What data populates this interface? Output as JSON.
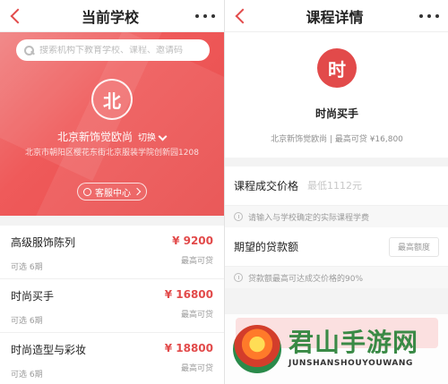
{
  "left": {
    "header": {
      "title": "当前学校"
    },
    "search": {
      "placeholder": "搜索机构下教育学校、课程、邀请码"
    },
    "school": {
      "logo_text": "北",
      "name": "北京新饰觉欧尚",
      "switch_label": "切换",
      "address": "北京市朝阳区樱花东街北京服装学院创新园1208",
      "service_label": "客服中心"
    },
    "courses": [
      {
        "name": "高级服饰陈列",
        "sub": "可选 6期",
        "price": "¥ 9200",
        "max": "最高可贷"
      },
      {
        "name": "时尚买手",
        "sub": "可选 6期",
        "price": "¥ 16800",
        "max": "最高可贷"
      },
      {
        "name": "时尚造型与彩妆",
        "sub": "可选 6期",
        "price": "¥ 18800",
        "max": "最高可贷"
      }
    ]
  },
  "right": {
    "header": {
      "title": "课程详情"
    },
    "course": {
      "logo_text": "时",
      "title": "时尚买手",
      "meta": "北京新饰觉欧尚 | 最高可贷 ¥16,800"
    },
    "form": {
      "price_label": "课程成交价格",
      "price_placeholder": "最低1112元",
      "price_hint": "请输入与学校确定的实际课程学费",
      "loan_label": "期望的贷款额",
      "loan_button": "最高额度",
      "loan_hint": "贷款额最高可达成交价格的90%"
    }
  },
  "watermark": {
    "title": "君山手游网",
    "subtitle": "JUNSHANSHOUYOUWANG"
  },
  "colors": {
    "accent": "#e24a4a",
    "green": "#3a8a46"
  }
}
